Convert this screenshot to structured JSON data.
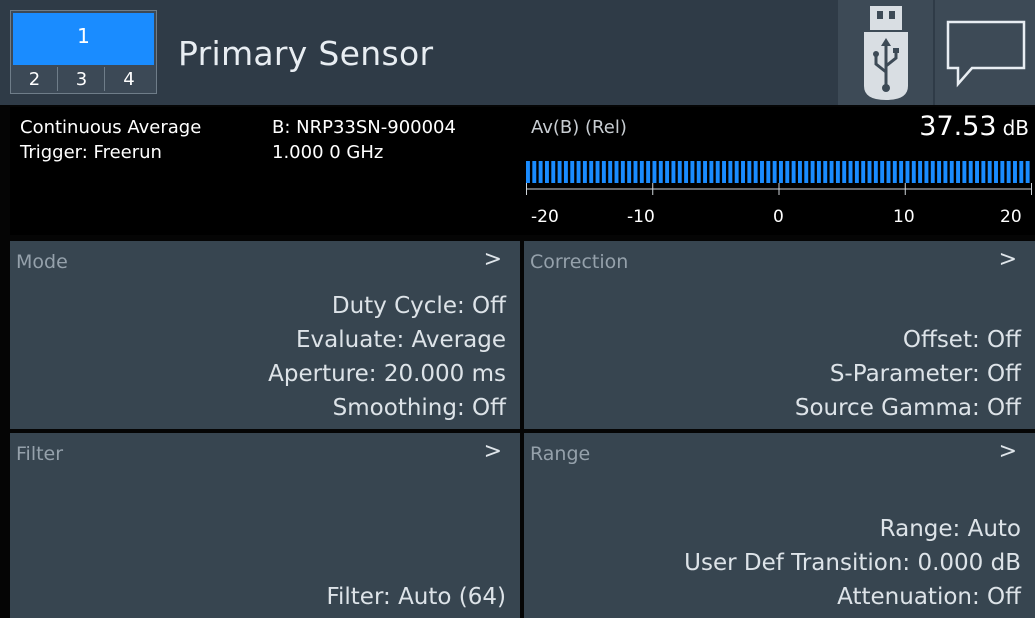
{
  "header": {
    "channels": {
      "active": "1",
      "others": [
        "2",
        "3",
        "4"
      ]
    },
    "title": "Primary Sensor",
    "icons": [
      "usb-icon",
      "chat-bubble-icon"
    ]
  },
  "measurement": {
    "mode": "Continuous Average",
    "trigger": "Trigger: Freerun",
    "sensor": "B: NRP33SN-900004",
    "frequency": "1.000 0 GHz",
    "function_label": "Av(B) (Rel)",
    "reading": {
      "value": "37.53",
      "unit": "dB"
    },
    "bar": {
      "min": -20,
      "max": 20,
      "level": 20,
      "segments": 80,
      "color": "#1a8cff"
    },
    "scale_ticks": [
      "-20",
      "-10",
      "0",
      "10",
      "20"
    ]
  },
  "tiles": {
    "mode": {
      "title": "Mode",
      "arrow": ">",
      "lines": [
        "Duty Cycle: Off",
        "Evaluate: Average",
        "Aperture: 20.000 ms",
        "Smoothing: Off"
      ]
    },
    "correction": {
      "title": "Correction",
      "arrow": ">",
      "lines": [
        "Offset: Off",
        "S-Parameter: Off",
        "Source Gamma: Off"
      ]
    },
    "filter": {
      "title": "Filter",
      "arrow": ">",
      "lines": [
        "Filter: Auto (64)"
      ]
    },
    "range": {
      "title": "Range",
      "arrow": ">",
      "lines": [
        "Range: Auto",
        "User Def Transition: 0.000 dB",
        "Attenuation: Off"
      ]
    }
  },
  "colors": {
    "accent": "#1a8cff",
    "tile_bg": "#374550",
    "header_bg": "#2f3b47",
    "background": "#000000"
  }
}
